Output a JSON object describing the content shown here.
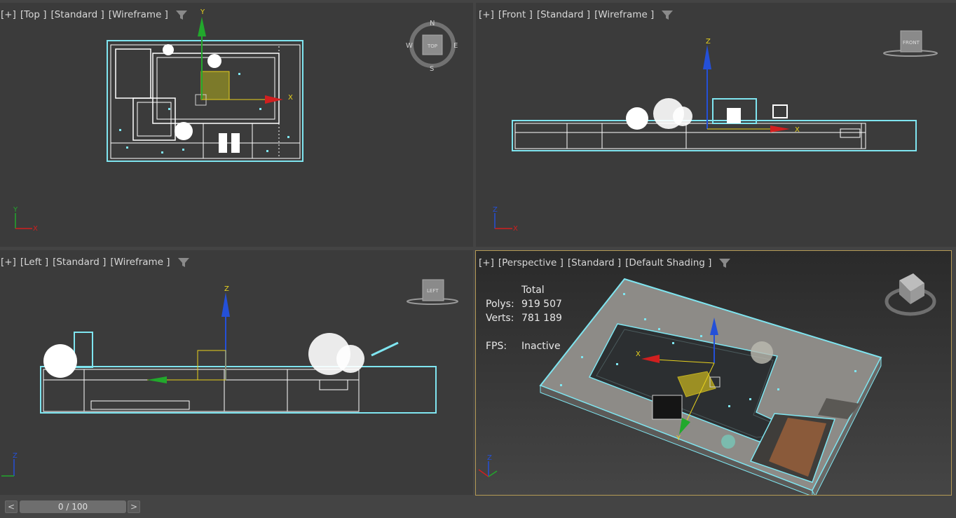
{
  "viewports": {
    "top": {
      "plus": "[+]",
      "view": "[Top ]",
      "preset": "[Standard ]",
      "shading": "[Wireframe ]"
    },
    "front": {
      "plus": "[+]",
      "view": "[Front ]",
      "preset": "[Standard ]",
      "shading": "[Wireframe ]"
    },
    "left": {
      "plus": "[+]",
      "view": "[Left ]",
      "preset": "[Standard ]",
      "shading": "[Wireframe ]"
    },
    "perspective": {
      "plus": "[+]",
      "view": "[Perspective ]",
      "preset": "[Standard ]",
      "shading": "[Default Shading ]"
    }
  },
  "stats": {
    "header": "Total",
    "polys_label": "Polys:",
    "polys_value": "919 507",
    "verts_label": "Verts:",
    "verts_value": "781 189",
    "fps_label": "FPS:",
    "fps_value": "Inactive"
  },
  "compass": {
    "n": "N",
    "s": "S",
    "e": "E",
    "w": "W",
    "top_cube": "TOP",
    "front_cube": "FRONT",
    "left_cube": "LEFT"
  },
  "axes": {
    "x": "X",
    "y": "Y",
    "z": "Z"
  },
  "timeline": {
    "prev": "<",
    "next": ">",
    "frame": "0 / 100"
  },
  "colors": {
    "viewport_bg": "#3b3b3b",
    "wire": "#7fe5f0",
    "active_border": "#b59a55",
    "axis_x": "#d11f1f",
    "axis_y": "#22a82c",
    "axis_z": "#2450d8",
    "gizmo_yellow": "#e8d21e"
  },
  "icons": [
    "filter-icon",
    "viewcube-icon",
    "compass-ring-icon",
    "axis-tripod-icon",
    "transform-gizmo-icon"
  ]
}
